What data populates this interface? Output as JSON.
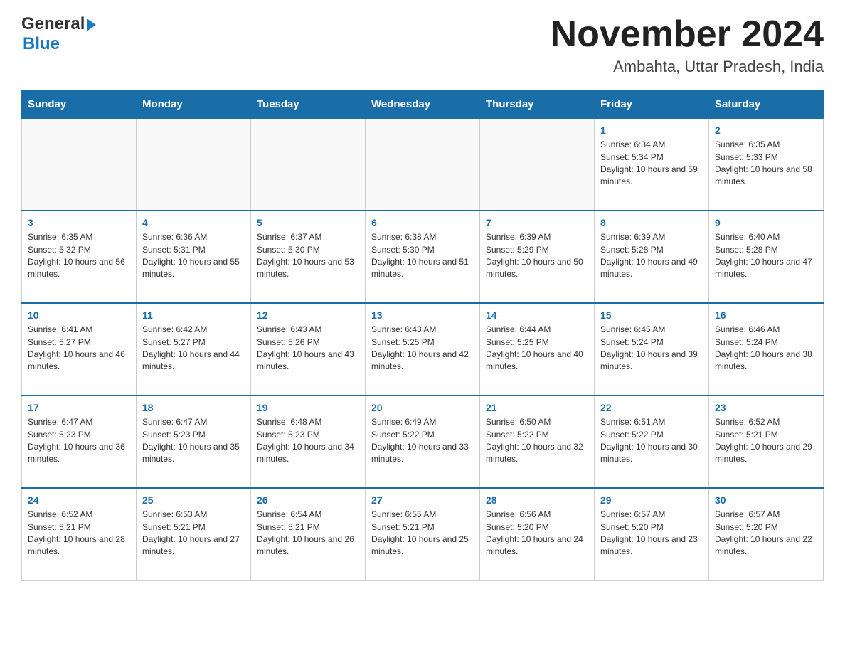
{
  "header": {
    "logo_line1": "General",
    "logo_line2": "Blue",
    "month_title": "November 2024",
    "location": "Ambahta, Uttar Pradesh, India"
  },
  "days_of_week": [
    "Sunday",
    "Monday",
    "Tuesday",
    "Wednesday",
    "Thursday",
    "Friday",
    "Saturday"
  ],
  "weeks": [
    [
      {
        "num": "",
        "info": ""
      },
      {
        "num": "",
        "info": ""
      },
      {
        "num": "",
        "info": ""
      },
      {
        "num": "",
        "info": ""
      },
      {
        "num": "",
        "info": ""
      },
      {
        "num": "1",
        "info": "Sunrise: 6:34 AM\nSunset: 5:34 PM\nDaylight: 10 hours and 59 minutes."
      },
      {
        "num": "2",
        "info": "Sunrise: 6:35 AM\nSunset: 5:33 PM\nDaylight: 10 hours and 58 minutes."
      }
    ],
    [
      {
        "num": "3",
        "info": "Sunrise: 6:35 AM\nSunset: 5:32 PM\nDaylight: 10 hours and 56 minutes."
      },
      {
        "num": "4",
        "info": "Sunrise: 6:36 AM\nSunset: 5:31 PM\nDaylight: 10 hours and 55 minutes."
      },
      {
        "num": "5",
        "info": "Sunrise: 6:37 AM\nSunset: 5:30 PM\nDaylight: 10 hours and 53 minutes."
      },
      {
        "num": "6",
        "info": "Sunrise: 6:38 AM\nSunset: 5:30 PM\nDaylight: 10 hours and 51 minutes."
      },
      {
        "num": "7",
        "info": "Sunrise: 6:39 AM\nSunset: 5:29 PM\nDaylight: 10 hours and 50 minutes."
      },
      {
        "num": "8",
        "info": "Sunrise: 6:39 AM\nSunset: 5:28 PM\nDaylight: 10 hours and 49 minutes."
      },
      {
        "num": "9",
        "info": "Sunrise: 6:40 AM\nSunset: 5:28 PM\nDaylight: 10 hours and 47 minutes."
      }
    ],
    [
      {
        "num": "10",
        "info": "Sunrise: 6:41 AM\nSunset: 5:27 PM\nDaylight: 10 hours and 46 minutes."
      },
      {
        "num": "11",
        "info": "Sunrise: 6:42 AM\nSunset: 5:27 PM\nDaylight: 10 hours and 44 minutes."
      },
      {
        "num": "12",
        "info": "Sunrise: 6:43 AM\nSunset: 5:26 PM\nDaylight: 10 hours and 43 minutes."
      },
      {
        "num": "13",
        "info": "Sunrise: 6:43 AM\nSunset: 5:25 PM\nDaylight: 10 hours and 42 minutes."
      },
      {
        "num": "14",
        "info": "Sunrise: 6:44 AM\nSunset: 5:25 PM\nDaylight: 10 hours and 40 minutes."
      },
      {
        "num": "15",
        "info": "Sunrise: 6:45 AM\nSunset: 5:24 PM\nDaylight: 10 hours and 39 minutes."
      },
      {
        "num": "16",
        "info": "Sunrise: 6:46 AM\nSunset: 5:24 PM\nDaylight: 10 hours and 38 minutes."
      }
    ],
    [
      {
        "num": "17",
        "info": "Sunrise: 6:47 AM\nSunset: 5:23 PM\nDaylight: 10 hours and 36 minutes."
      },
      {
        "num": "18",
        "info": "Sunrise: 6:47 AM\nSunset: 5:23 PM\nDaylight: 10 hours and 35 minutes."
      },
      {
        "num": "19",
        "info": "Sunrise: 6:48 AM\nSunset: 5:23 PM\nDaylight: 10 hours and 34 minutes."
      },
      {
        "num": "20",
        "info": "Sunrise: 6:49 AM\nSunset: 5:22 PM\nDaylight: 10 hours and 33 minutes."
      },
      {
        "num": "21",
        "info": "Sunrise: 6:50 AM\nSunset: 5:22 PM\nDaylight: 10 hours and 32 minutes."
      },
      {
        "num": "22",
        "info": "Sunrise: 6:51 AM\nSunset: 5:22 PM\nDaylight: 10 hours and 30 minutes."
      },
      {
        "num": "23",
        "info": "Sunrise: 6:52 AM\nSunset: 5:21 PM\nDaylight: 10 hours and 29 minutes."
      }
    ],
    [
      {
        "num": "24",
        "info": "Sunrise: 6:52 AM\nSunset: 5:21 PM\nDaylight: 10 hours and 28 minutes."
      },
      {
        "num": "25",
        "info": "Sunrise: 6:53 AM\nSunset: 5:21 PM\nDaylight: 10 hours and 27 minutes."
      },
      {
        "num": "26",
        "info": "Sunrise: 6:54 AM\nSunset: 5:21 PM\nDaylight: 10 hours and 26 minutes."
      },
      {
        "num": "27",
        "info": "Sunrise: 6:55 AM\nSunset: 5:21 PM\nDaylight: 10 hours and 25 minutes."
      },
      {
        "num": "28",
        "info": "Sunrise: 6:56 AM\nSunset: 5:20 PM\nDaylight: 10 hours and 24 minutes."
      },
      {
        "num": "29",
        "info": "Sunrise: 6:57 AM\nSunset: 5:20 PM\nDaylight: 10 hours and 23 minutes."
      },
      {
        "num": "30",
        "info": "Sunrise: 6:57 AM\nSunset: 5:20 PM\nDaylight: 10 hours and 22 minutes."
      }
    ]
  ]
}
